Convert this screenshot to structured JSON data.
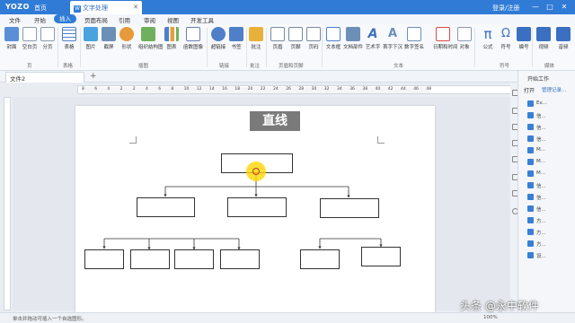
{
  "titlebar": {
    "logo": "YOZO",
    "home": "首页",
    "doc_tab": "文字处理",
    "login": "登录/注册",
    "min": "—",
    "max": "□",
    "close": "✕"
  },
  "menu": [
    "文件",
    "开始",
    "插入",
    "页面布局",
    "引用",
    "审阅",
    "视图",
    "开发工具"
  ],
  "menu_active_index": 2,
  "ribbon": {
    "buttons": [
      {
        "label": "封面",
        "color": "#5a8fd8"
      },
      {
        "label": "空白页",
        "color": "#8a9bb0"
      },
      {
        "label": "分页",
        "color": "#8a9bb0"
      },
      {
        "label": "表格",
        "color": "#4f7fc9"
      },
      {
        "label": "图片",
        "color": "#4aa3df"
      },
      {
        "label": "截屏",
        "color": "#6c8fb8"
      },
      {
        "label": "形状",
        "color": "#e69a3a"
      },
      {
        "label": "组织结构图",
        "color": "#6fb05c"
      },
      {
        "label": "图表",
        "color": "#e2a23a"
      },
      {
        "label": "函数图像",
        "color": "#6b7db5"
      },
      {
        "label": "超链接",
        "color": "#4f7fc9"
      },
      {
        "label": "书签",
        "color": "#4f7fc9"
      },
      {
        "label": "批注",
        "color": "#e8b13a"
      },
      {
        "label": "页眉",
        "color": "#7a8aa0"
      },
      {
        "label": "页脚",
        "color": "#7a8aa0"
      },
      {
        "label": "页码",
        "color": "#7a8aa0"
      },
      {
        "label": "文本框",
        "color": "#4f7fc9"
      },
      {
        "label": "文档部件",
        "color": "#6c8fb8"
      },
      {
        "label": "艺术字",
        "color": "#3b6fc2"
      },
      {
        "label": "首字下沉",
        "color": "#6c8fb8"
      },
      {
        "label": "数字签名",
        "color": "#6c8fb8"
      },
      {
        "label": "日期和时间",
        "color": "#d84a4a"
      },
      {
        "label": "对象",
        "color": "#8a9bb0"
      },
      {
        "label": "公式",
        "color": "#3b6fc2"
      },
      {
        "label": "符号",
        "color": "#3b6fc2"
      },
      {
        "label": "编号",
        "color": "#3b6fc2"
      },
      {
        "label": "视频",
        "color": "#3b6fc2"
      },
      {
        "label": "音频",
        "color": "#3b6fc2"
      }
    ],
    "groups": [
      "页",
      "表格",
      "插图",
      "链接",
      "批注",
      "页眉和页脚",
      "文本",
      "符号",
      "媒体"
    ]
  },
  "doc_tab": {
    "label": "文件2",
    "add": "+"
  },
  "ruler_numbers": [
    "8",
    "6",
    "4",
    "2",
    "2",
    "4",
    "6",
    "8",
    "10",
    "12",
    "14",
    "16",
    "18",
    "20",
    "22",
    "24",
    "26",
    "28",
    "30",
    "32",
    "34",
    "36",
    "38",
    "40",
    "42",
    "44",
    "46",
    "48"
  ],
  "document": {
    "title": "直线"
  },
  "right_panel": {
    "title": "开始工作",
    "open": "打开",
    "manage": "管理记录...",
    "items": [
      "Ex...",
      "信...",
      "信...",
      "信...",
      "M...",
      "M...",
      "M...",
      "信...",
      "信...",
      "信...",
      "方...",
      "方...",
      "方...",
      "设..."
    ]
  },
  "status": {
    "text": "单击并拖动可插入一个自选图形。",
    "zoom": "100%"
  },
  "watermark": "头条 @永中软件"
}
